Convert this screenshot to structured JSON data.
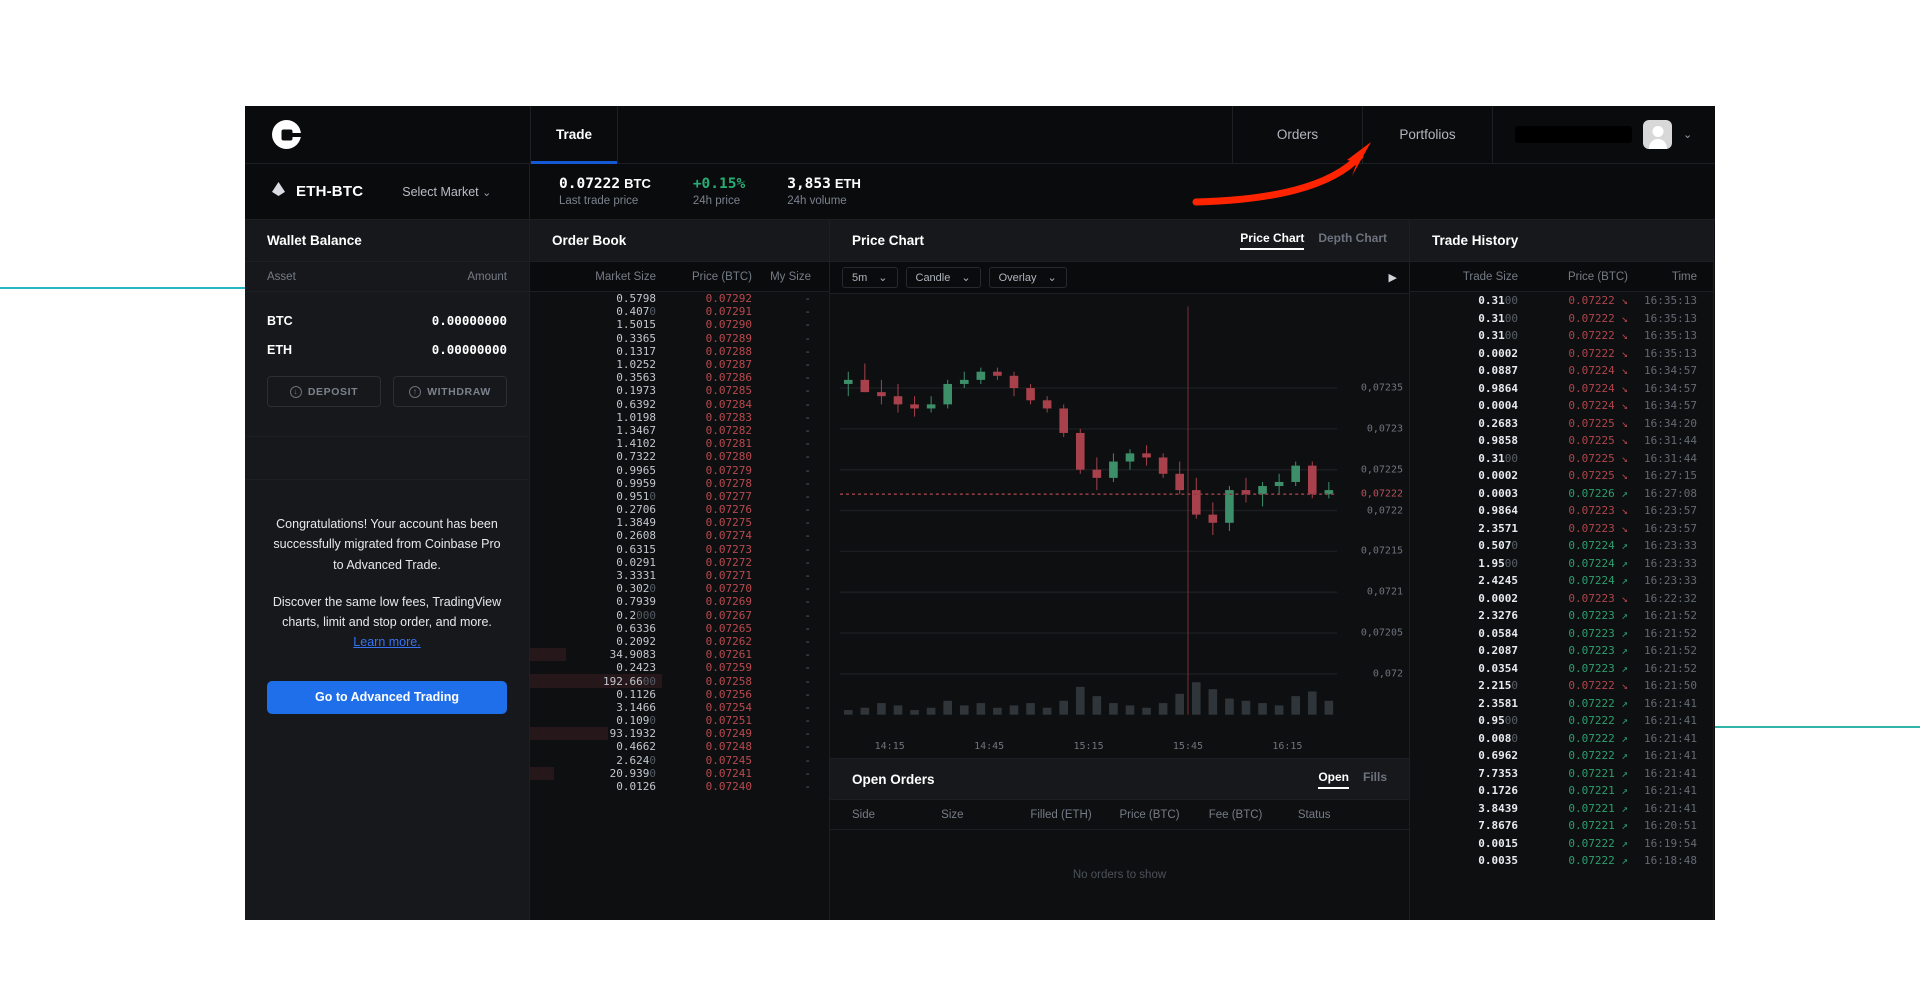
{
  "topnav": {
    "logo": "coinbase-logo",
    "tabs": [
      {
        "label": "Trade",
        "active": true
      }
    ],
    "links": [
      {
        "label": "Orders"
      },
      {
        "label": "Portfolios"
      }
    ],
    "user": {
      "name_redacted": "",
      "chevron": "⌄"
    }
  },
  "marketbar": {
    "pair": "ETH-BTC",
    "select_market": "Select Market",
    "chevron": "⌄",
    "stats": [
      {
        "value": "0.07222",
        "unit": "BTC",
        "label": "Last trade price",
        "up": false
      },
      {
        "value": "+0.15%",
        "unit": "",
        "label": "24h price",
        "up": true
      },
      {
        "value": "3,853",
        "unit": "ETH",
        "label": "24h volume",
        "up": false
      }
    ]
  },
  "wallet": {
    "title": "Wallet Balance",
    "columns": [
      "Asset",
      "Amount"
    ],
    "rows": [
      {
        "asset": "BTC",
        "amount": "0.00000000"
      },
      {
        "asset": "ETH",
        "amount": "0.00000000"
      }
    ],
    "deposit_label": "DEPOSIT",
    "withdraw_label": "WITHDRAW",
    "deposit_icon": "↓",
    "withdraw_icon": "↑"
  },
  "promo": {
    "line1": "Congratulations! Your account has been successfully migrated from Coinbase Pro to Advanced Trade.",
    "line2": "Discover the same low fees, TradingView charts, limit and stop order, and more.",
    "link": "Learn more.",
    "button": "Go to Advanced Trading"
  },
  "orderbook": {
    "title": "Order Book",
    "columns": [
      "Market Size",
      "Price (BTC)",
      "My Size"
    ],
    "rows": [
      {
        "size": "0.5798",
        "dim": "",
        "price": "0.07292",
        "my": "-",
        "bar": 0
      },
      {
        "size": "0.407",
        "dim": "0",
        "price": "0.07291",
        "my": "-",
        "bar": 0
      },
      {
        "size": "1.5015",
        "dim": "",
        "price": "0.07290",
        "my": "-",
        "bar": 0
      },
      {
        "size": "0.3365",
        "dim": "",
        "price": "0.07289",
        "my": "-",
        "bar": 0
      },
      {
        "size": "0.1317",
        "dim": "",
        "price": "0.07288",
        "my": "-",
        "bar": 0
      },
      {
        "size": "1.0252",
        "dim": "",
        "price": "0.07287",
        "my": "-",
        "bar": 0
      },
      {
        "size": "0.3563",
        "dim": "",
        "price": "0.07286",
        "my": "-",
        "bar": 0
      },
      {
        "size": "0.1973",
        "dim": "",
        "price": "0.07285",
        "my": "-",
        "bar": 0
      },
      {
        "size": "0.6392",
        "dim": "",
        "price": "0.07284",
        "my": "-",
        "bar": 0
      },
      {
        "size": "1.0198",
        "dim": "",
        "price": "0.07283",
        "my": "-",
        "bar": 0
      },
      {
        "size": "1.3467",
        "dim": "",
        "price": "0.07282",
        "my": "-",
        "bar": 0
      },
      {
        "size": "1.4102",
        "dim": "",
        "price": "0.07281",
        "my": "-",
        "bar": 0
      },
      {
        "size": "0.7322",
        "dim": "",
        "price": "0.07280",
        "my": "-",
        "bar": 0
      },
      {
        "size": "0.9965",
        "dim": "",
        "price": "0.07279",
        "my": "-",
        "bar": 0
      },
      {
        "size": "0.9959",
        "dim": "",
        "price": "0.07278",
        "my": "-",
        "bar": 0
      },
      {
        "size": "0.951",
        "dim": "0",
        "price": "0.07277",
        "my": "-",
        "bar": 0
      },
      {
        "size": "0.2706",
        "dim": "",
        "price": "0.07276",
        "my": "-",
        "bar": 0
      },
      {
        "size": "1.3849",
        "dim": "",
        "price": "0.07275",
        "my": "-",
        "bar": 0
      },
      {
        "size": "0.2608",
        "dim": "",
        "price": "0.07274",
        "my": "-",
        "bar": 0
      },
      {
        "size": "0.6315",
        "dim": "",
        "price": "0.07273",
        "my": "-",
        "bar": 0
      },
      {
        "size": "0.0291",
        "dim": "",
        "price": "0.07272",
        "my": "-",
        "bar": 0
      },
      {
        "size": "3.3331",
        "dim": "",
        "price": "0.07271",
        "my": "-",
        "bar": 0
      },
      {
        "size": "0.302",
        "dim": "0",
        "price": "0.07270",
        "my": "-",
        "bar": 0
      },
      {
        "size": "0.7939",
        "dim": "",
        "price": "0.07269",
        "my": "-",
        "bar": 0
      },
      {
        "size": "0.2",
        "dim": "000",
        "price": "0.07267",
        "my": "-",
        "bar": 0
      },
      {
        "size": "0.6336",
        "dim": "",
        "price": "0.07265",
        "my": "-",
        "bar": 0
      },
      {
        "size": "0.2092",
        "dim": "",
        "price": "0.07262",
        "my": "-",
        "bar": 0
      },
      {
        "size": "34.9083",
        "dim": "",
        "price": "0.07261",
        "my": "-",
        "bar": 12
      },
      {
        "size": "0.2423",
        "dim": "",
        "price": "0.07259",
        "my": "-",
        "bar": 0
      },
      {
        "size": "192.66",
        "dim": "00",
        "price": "0.07258",
        "my": "-",
        "bar": 44
      },
      {
        "size": "0.1126",
        "dim": "",
        "price": "0.07256",
        "my": "-",
        "bar": 0
      },
      {
        "size": "3.1466",
        "dim": "",
        "price": "0.07254",
        "my": "-",
        "bar": 0
      },
      {
        "size": "0.109",
        "dim": "0",
        "price": "0.07251",
        "my": "-",
        "bar": 0
      },
      {
        "size": "93.1932",
        "dim": "",
        "price": "0.07249",
        "my": "-",
        "bar": 26
      },
      {
        "size": "0.4662",
        "dim": "",
        "price": "0.07248",
        "my": "-",
        "bar": 0
      },
      {
        "size": "2.624",
        "dim": "0",
        "price": "0.07245",
        "my": "-",
        "bar": 0
      },
      {
        "size": "20.939",
        "dim": "0",
        "price": "0.07241",
        "my": "-",
        "bar": 8
      },
      {
        "size": "0.0126",
        "dim": "",
        "price": "0.07240",
        "my": "-",
        "bar": 0
      }
    ]
  },
  "chart": {
    "title": "Price Chart",
    "tabs": [
      {
        "label": "Price Chart",
        "active": true
      },
      {
        "label": "Depth Chart",
        "active": false
      }
    ],
    "toolbar": [
      {
        "label": "5m",
        "chevron": "⌄"
      },
      {
        "label": "Candle",
        "chevron": "⌄"
      },
      {
        "label": "Overlay",
        "chevron": "⌄"
      }
    ],
    "play_icon": "▶"
  },
  "chart_data": {
    "type": "candlestick",
    "title": "Price Chart",
    "xlabel": "",
    "ylabel": "",
    "ylim": [
      0.07195,
      0.07245
    ],
    "y_ticks": [
      "0,07235",
      "0,0723",
      "0,07225",
      "0,0722",
      "0,07215",
      "0,0721",
      "0,07205",
      "0,072"
    ],
    "y_tick_values": [
      0.07235,
      0.0723,
      0.07225,
      0.0722,
      0.07215,
      0.0721,
      0.07205,
      0.072
    ],
    "current_price_label": "0,07222",
    "current_price_value": 0.07222,
    "x_ticks": [
      "14:15",
      "14:45",
      "15:15",
      "15:45",
      "16:15"
    ],
    "grid": true,
    "legend_position": "none",
    "candles": [
      {
        "o": 0.072355,
        "h": 0.07237,
        "l": 0.07234,
        "c": 0.07236,
        "v": 2
      },
      {
        "o": 0.07236,
        "h": 0.07238,
        "l": 0.072345,
        "c": 0.072345,
        "v": 3
      },
      {
        "o": 0.072345,
        "h": 0.07236,
        "l": 0.07233,
        "c": 0.07234,
        "v": 5
      },
      {
        "o": 0.07234,
        "h": 0.072355,
        "l": 0.07232,
        "c": 0.07233,
        "v": 4
      },
      {
        "o": 0.07233,
        "h": 0.07234,
        "l": 0.072315,
        "c": 0.072325,
        "v": 2
      },
      {
        "o": 0.072325,
        "h": 0.07234,
        "l": 0.07232,
        "c": 0.07233,
        "v": 3
      },
      {
        "o": 0.07233,
        "h": 0.07236,
        "l": 0.072325,
        "c": 0.072355,
        "v": 6
      },
      {
        "o": 0.072355,
        "h": 0.07237,
        "l": 0.07235,
        "c": 0.07236,
        "v": 4
      },
      {
        "o": 0.07236,
        "h": 0.072375,
        "l": 0.072355,
        "c": 0.07237,
        "v": 5
      },
      {
        "o": 0.07237,
        "h": 0.072375,
        "l": 0.07236,
        "c": 0.072365,
        "v": 3
      },
      {
        "o": 0.072365,
        "h": 0.07237,
        "l": 0.07234,
        "c": 0.07235,
        "v": 4
      },
      {
        "o": 0.07235,
        "h": 0.072355,
        "l": 0.07233,
        "c": 0.072335,
        "v": 5
      },
      {
        "o": 0.072335,
        "h": 0.07234,
        "l": 0.07232,
        "c": 0.072325,
        "v": 3
      },
      {
        "o": 0.072325,
        "h": 0.07233,
        "l": 0.07229,
        "c": 0.072295,
        "v": 6
      },
      {
        "o": 0.072295,
        "h": 0.0723,
        "l": 0.072245,
        "c": 0.07225,
        "v": 12
      },
      {
        "o": 0.07225,
        "h": 0.072265,
        "l": 0.072225,
        "c": 0.07224,
        "v": 8
      },
      {
        "o": 0.07224,
        "h": 0.07227,
        "l": 0.072235,
        "c": 0.07226,
        "v": 5
      },
      {
        "o": 0.07226,
        "h": 0.072275,
        "l": 0.07225,
        "c": 0.07227,
        "v": 4
      },
      {
        "o": 0.07227,
        "h": 0.07228,
        "l": 0.072255,
        "c": 0.072265,
        "v": 3
      },
      {
        "o": 0.072265,
        "h": 0.07227,
        "l": 0.07224,
        "c": 0.072245,
        "v": 5
      },
      {
        "o": 0.072245,
        "h": 0.07226,
        "l": 0.07222,
        "c": 0.072225,
        "v": 9
      },
      {
        "o": 0.072225,
        "h": 0.07224,
        "l": 0.07219,
        "c": 0.072195,
        "v": 14
      },
      {
        "o": 0.072195,
        "h": 0.07221,
        "l": 0.07217,
        "c": 0.072185,
        "v": 11
      },
      {
        "o": 0.072185,
        "h": 0.07223,
        "l": 0.072175,
        "c": 0.072225,
        "v": 7
      },
      {
        "o": 0.072225,
        "h": 0.07224,
        "l": 0.07221,
        "c": 0.07222,
        "v": 6
      },
      {
        "o": 0.07222,
        "h": 0.072235,
        "l": 0.072205,
        "c": 0.07223,
        "v": 5
      },
      {
        "o": 0.07223,
        "h": 0.072245,
        "l": 0.07222,
        "c": 0.072235,
        "v": 4
      },
      {
        "o": 0.072235,
        "h": 0.07226,
        "l": 0.07223,
        "c": 0.072255,
        "v": 8
      },
      {
        "o": 0.072255,
        "h": 0.07226,
        "l": 0.072215,
        "c": 0.07222,
        "v": 10
      },
      {
        "o": 0.07222,
        "h": 0.072235,
        "l": 0.072215,
        "c": 0.072225,
        "v": 6
      }
    ]
  },
  "open_orders": {
    "title": "Open Orders",
    "tabs": [
      {
        "label": "Open",
        "active": true
      },
      {
        "label": "Fills",
        "active": false
      }
    ],
    "columns": [
      "Side",
      "Size",
      "Filled (ETH)",
      "Price (BTC)",
      "Fee (BTC)",
      "Status"
    ],
    "empty_text": "No orders to show"
  },
  "trade_history": {
    "title": "Trade History",
    "columns": [
      "Trade Size",
      "Price (BTC)",
      "Time"
    ],
    "rows": [
      {
        "size": "0.31",
        "dim": "00",
        "price": "0.07222",
        "dir": "down",
        "time": "16:35:13"
      },
      {
        "size": "0.31",
        "dim": "00",
        "price": "0.07222",
        "dir": "down",
        "time": "16:35:13"
      },
      {
        "size": "0.31",
        "dim": "00",
        "price": "0.07222",
        "dir": "down",
        "time": "16:35:13"
      },
      {
        "size": "0.0002",
        "dim": "",
        "price": "0.07222",
        "dir": "down",
        "time": "16:35:13"
      },
      {
        "size": "0.0887",
        "dim": "",
        "price": "0.07224",
        "dir": "down",
        "time": "16:34:57"
      },
      {
        "size": "0.9864",
        "dim": "",
        "price": "0.07224",
        "dir": "down",
        "time": "16:34:57"
      },
      {
        "size": "0.0004",
        "dim": "",
        "price": "0.07224",
        "dir": "down",
        "time": "16:34:57"
      },
      {
        "size": "0.2683",
        "dim": "",
        "price": "0.07225",
        "dir": "down",
        "time": "16:34:20"
      },
      {
        "size": "0.9858",
        "dim": "",
        "price": "0.07225",
        "dir": "down",
        "time": "16:31:44"
      },
      {
        "size": "0.31",
        "dim": "00",
        "price": "0.07225",
        "dir": "down",
        "time": "16:31:44"
      },
      {
        "size": "0.0002",
        "dim": "",
        "price": "0.07225",
        "dir": "down",
        "time": "16:27:15"
      },
      {
        "size": "0.0003",
        "dim": "",
        "price": "0.07226",
        "dir": "up",
        "time": "16:27:08"
      },
      {
        "size": "0.9864",
        "dim": "",
        "price": "0.07223",
        "dir": "down",
        "time": "16:23:57"
      },
      {
        "size": "2.3571",
        "dim": "",
        "price": "0.07223",
        "dir": "down",
        "time": "16:23:57"
      },
      {
        "size": "0.507",
        "dim": "0",
        "price": "0.07224",
        "dir": "up",
        "time": "16:23:33"
      },
      {
        "size": "1.95",
        "dim": "00",
        "price": "0.07224",
        "dir": "up",
        "time": "16:23:33"
      },
      {
        "size": "2.4245",
        "dim": "",
        "price": "0.07224",
        "dir": "up",
        "time": "16:23:33"
      },
      {
        "size": "0.0002",
        "dim": "",
        "price": "0.07223",
        "dir": "down",
        "time": "16:22:32"
      },
      {
        "size": "2.3276",
        "dim": "",
        "price": "0.07223",
        "dir": "up",
        "time": "16:21:52"
      },
      {
        "size": "0.0584",
        "dim": "",
        "price": "0.07223",
        "dir": "up",
        "time": "16:21:52"
      },
      {
        "size": "0.2087",
        "dim": "",
        "price": "0.07223",
        "dir": "up",
        "time": "16:21:52"
      },
      {
        "size": "0.0354",
        "dim": "",
        "price": "0.07223",
        "dir": "up",
        "time": "16:21:52"
      },
      {
        "size": "2.215",
        "dim": "0",
        "price": "0.07222",
        "dir": "down",
        "time": "16:21:50"
      },
      {
        "size": "2.3581",
        "dim": "",
        "price": "0.07222",
        "dir": "up",
        "time": "16:21:41"
      },
      {
        "size": "0.95",
        "dim": "00",
        "price": "0.07222",
        "dir": "up",
        "time": "16:21:41"
      },
      {
        "size": "0.008",
        "dim": "0",
        "price": "0.07222",
        "dir": "up",
        "time": "16:21:41"
      },
      {
        "size": "0.6962",
        "dim": "",
        "price": "0.07222",
        "dir": "up",
        "time": "16:21:41"
      },
      {
        "size": "7.7353",
        "dim": "",
        "price": "0.07221",
        "dir": "up",
        "time": "16:21:41"
      },
      {
        "size": "0.1726",
        "dim": "",
        "price": "0.07221",
        "dir": "up",
        "time": "16:21:41"
      },
      {
        "size": "3.8439",
        "dim": "",
        "price": "0.07221",
        "dir": "up",
        "time": "16:21:41"
      },
      {
        "size": "7.8676",
        "dim": "",
        "price": "0.07221",
        "dir": "up",
        "time": "16:20:51"
      },
      {
        "size": "0.0015",
        "dim": "",
        "price": "0.07222",
        "dir": "up",
        "time": "16:19:54"
      },
      {
        "size": "0.0035",
        "dim": "",
        "price": "0.07222",
        "dir": "up",
        "time": "16:18:48"
      }
    ]
  },
  "annotation": {
    "type": "red-arrow",
    "points_to": "Portfolios",
    "color": "#ff2400"
  }
}
